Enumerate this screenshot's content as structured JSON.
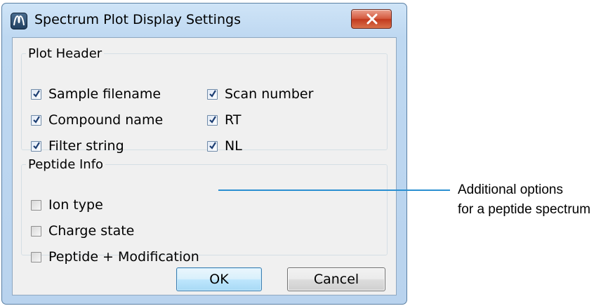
{
  "window": {
    "title": "Spectrum Plot Display Settings",
    "icon": "thermo-app-icon",
    "close_icon": "close-icon"
  },
  "plot_header": {
    "legend": "Plot Header",
    "options": [
      {
        "label": "Sample filename",
        "checked": true
      },
      {
        "label": "Compound name",
        "checked": true
      },
      {
        "label": "Filter string",
        "checked": true
      },
      {
        "label": "Scan number",
        "checked": true
      },
      {
        "label": "RT",
        "checked": true
      },
      {
        "label": "NL",
        "checked": true
      }
    ]
  },
  "peptide_info": {
    "legend": "Peptide Info",
    "options": [
      {
        "label": "Ion type",
        "checked": false
      },
      {
        "label": "Charge state",
        "checked": false
      },
      {
        "label": "Peptide + Modification",
        "checked": false
      }
    ]
  },
  "buttons": {
    "ok": "OK",
    "cancel": "Cancel"
  },
  "callout": {
    "line1": "Additional options",
    "line2": "for a peptide spectrum",
    "color": "#2a8fd1"
  }
}
